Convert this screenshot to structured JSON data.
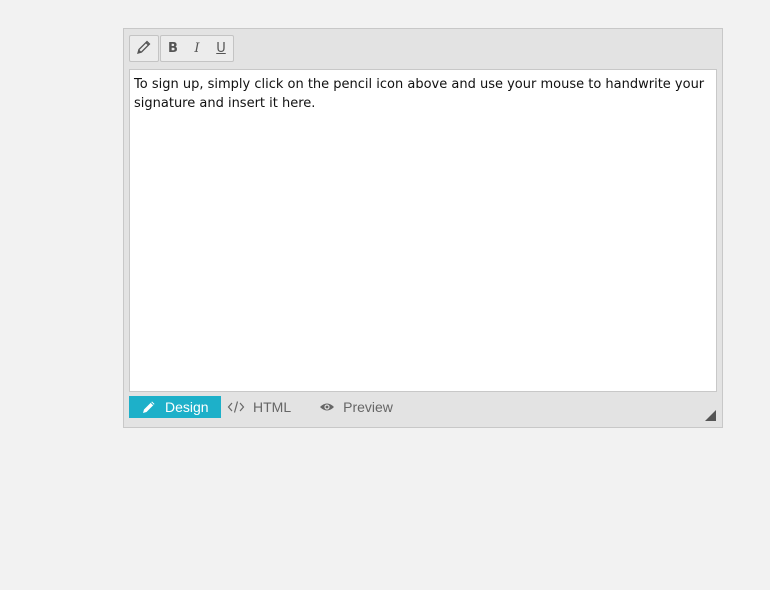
{
  "toolbar": {
    "tools": [
      {
        "name": "pencil",
        "icon": "pencil-icon"
      },
      {
        "name": "bold",
        "label": "B"
      },
      {
        "name": "italic",
        "label": "I"
      },
      {
        "name": "underline",
        "label": "U"
      }
    ]
  },
  "content": {
    "text": "To sign up, simply click on the pencil icon above and use your mouse to handwrite your signature and insert it here."
  },
  "modes": [
    {
      "label": "Design",
      "icon": "pencil-icon",
      "active": true
    },
    {
      "label": "HTML",
      "icon": "code-icon",
      "active": false
    },
    {
      "label": "Preview",
      "icon": "eye-icon",
      "active": false
    }
  ],
  "colors": {
    "accent": "#1db0c9",
    "background": "#f2f2f2",
    "editor_frame": "#e3e3e3"
  }
}
